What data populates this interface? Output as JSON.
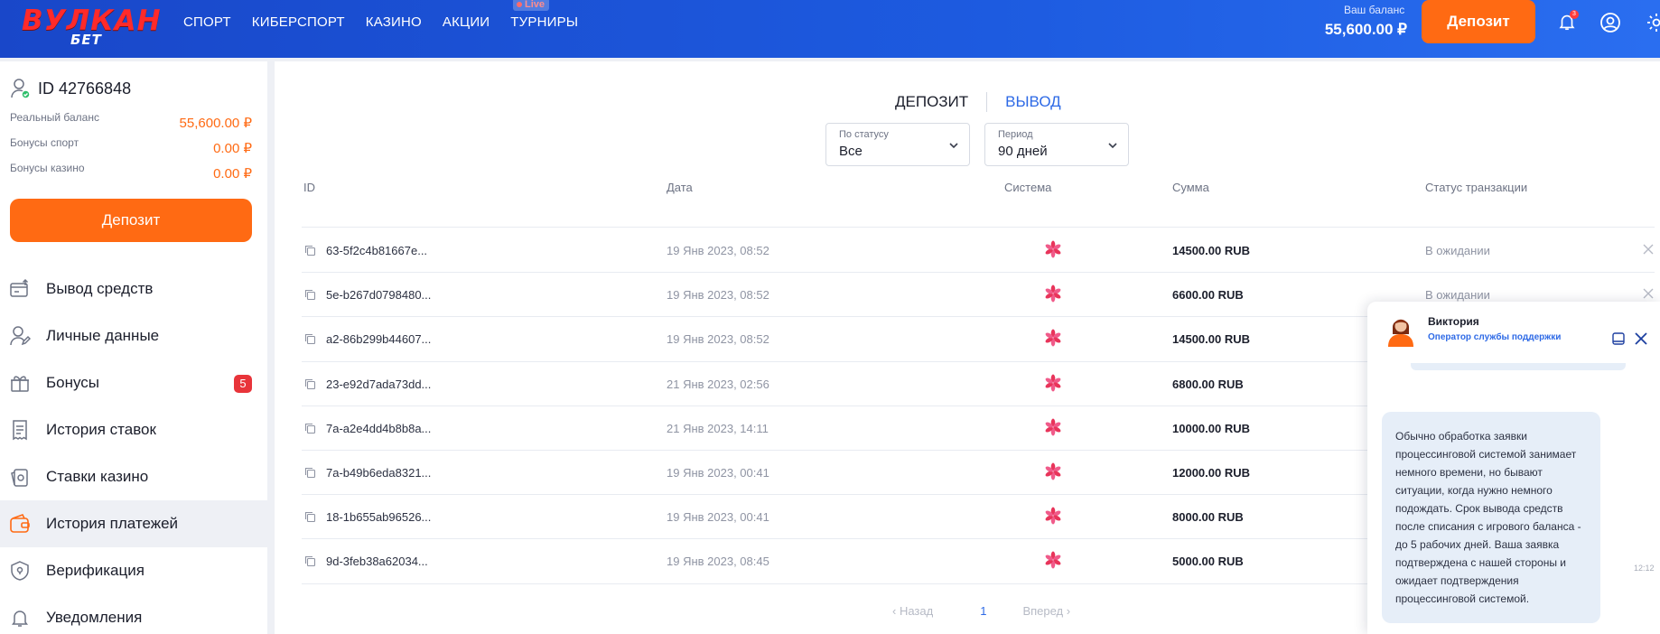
{
  "header": {
    "logo_main": "ВУЛКАН",
    "logo_sub": "БЕТ",
    "nav": [
      "СПОРТ",
      "КИБЕРСПОРТ",
      "КАЗИНО",
      "АКЦИИ",
      "ТУРНИРЫ"
    ],
    "live_badge": "Live",
    "balance_label": "Ваш баланс",
    "balance_value": "55,600.00 ₽",
    "deposit_label": "Депозит",
    "notifications_count": "3"
  },
  "sidebar": {
    "user_id": "ID 42766848",
    "balances": [
      {
        "label": "Реальный баланс",
        "value": "55,600.00 ₽"
      },
      {
        "label": "Бонусы спорт",
        "value": "0.00 ₽"
      },
      {
        "label": "Бонусы казино",
        "value": "0.00 ₽"
      }
    ],
    "deposit_label": "Депозит",
    "menu": [
      {
        "label": "Вывод средств",
        "icon": "withdraw-icon"
      },
      {
        "label": "Личные данные",
        "icon": "user-profile-icon"
      },
      {
        "label": "Бонусы",
        "icon": "gift-icon",
        "badge": "5"
      },
      {
        "label": "История ставок",
        "icon": "receipt-icon"
      },
      {
        "label": "Ставки казино",
        "icon": "cards-icon"
      },
      {
        "label": "История платежей",
        "icon": "wallet-icon",
        "active": true
      },
      {
        "label": "Верификация",
        "icon": "shield-icon"
      },
      {
        "label": "Уведомления",
        "icon": "bell-icon"
      }
    ]
  },
  "main": {
    "tabs": {
      "deposit": "ДЕПОЗИТ",
      "withdraw": "ВЫВОД"
    },
    "filters": {
      "status": {
        "label": "По статусу",
        "value": "Все"
      },
      "period": {
        "label": "Период",
        "value": "90 дней"
      }
    },
    "columns": {
      "id": "ID",
      "date": "Дата",
      "system": "Система",
      "sum": "Сумма",
      "status": "Статус транзакции"
    },
    "rows": [
      {
        "id": "63-5f2c4b81667e...",
        "date": "19 Янв 2023, 08:52",
        "sum": "14500.00 RUB",
        "status": "В ожидании",
        "cancel": true
      },
      {
        "id": "5e-b267d0798480...",
        "date": "19 Янв 2023, 08:52",
        "sum": "6600.00 RUB",
        "status": "В ожидании",
        "cancel": true
      },
      {
        "id": "a2-86b299b44607...",
        "date": "19 Янв 2023, 08:52",
        "sum": "14500.00 RUB",
        "status": "",
        "cancel": false
      },
      {
        "id": "23-e92d7ada73dd...",
        "date": "21 Янв 2023, 02:56",
        "sum": "6800.00 RUB",
        "status": "",
        "cancel": false
      },
      {
        "id": "7a-a2e4dd4b8b8a...",
        "date": "21 Янв 2023, 14:11",
        "sum": "10000.00 RUB",
        "status": "",
        "cancel": false
      },
      {
        "id": "7a-b49b6eda8321...",
        "date": "19 Янв 2023, 00:41",
        "sum": "12000.00 RUB",
        "status": "",
        "cancel": false
      },
      {
        "id": "18-1b655ab96526...",
        "date": "19 Янв 2023, 00:41",
        "sum": "8000.00 RUB",
        "status": "",
        "cancel": false
      },
      {
        "id": "9d-3feb38a62034...",
        "date": "19 Янв 2023, 08:45",
        "sum": "5000.00 RUB",
        "status": "",
        "cancel": false
      }
    ],
    "pager": {
      "prev": "Назад",
      "page": "1",
      "next": "Вперед"
    }
  },
  "chat": {
    "operator_name": "Виктория",
    "operator_role": "Оператор службы поддержки",
    "message": "Обычно обработка заявки процессинговой системой занимает немного времени, но бывают ситуации, когда нужно немного подождать. Срок вывода средств после списания с игрового баланса - до 5 рабочих дней. Ваша заявка подтверждена с нашей стороны и ожидает подтверждения процессинговой системой.",
    "time": "12:12"
  },
  "colors": {
    "brand_blue": "#1d5be0",
    "accent_orange": "#ff6a13",
    "badge_red": "#e8343a",
    "link_blue": "#2e6ae6"
  }
}
